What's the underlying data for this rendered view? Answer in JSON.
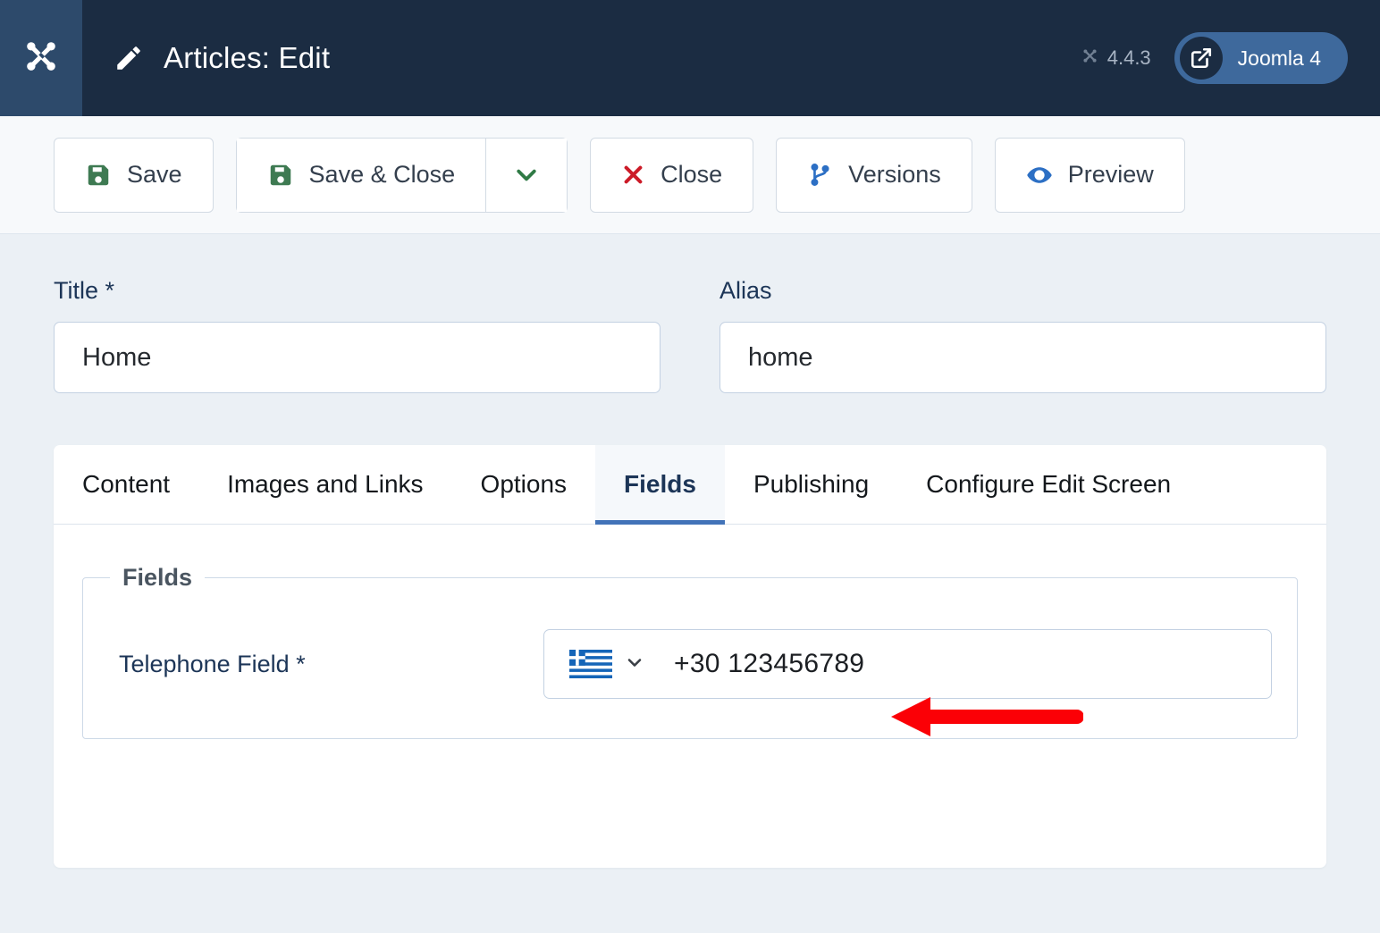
{
  "header": {
    "logo_icon": "joomla-logo-icon",
    "pencil_icon": "pencil-icon",
    "title": "Articles: Edit",
    "version_icon": "joomla-mark-icon",
    "version": "4.4.3",
    "switch_icon": "external-link-icon",
    "switch_label": "Joomla 4"
  },
  "toolbar": {
    "save_label": "Save",
    "save_icon": "floppy-disk-icon",
    "save_close_label": "Save & Close",
    "save_close_icon": "floppy-disk-icon",
    "caret_icon": "chevron-down-icon",
    "close_label": "Close",
    "close_icon": "x-icon",
    "versions_label": "Versions",
    "versions_icon": "code-branch-icon",
    "preview_label": "Preview",
    "preview_icon": "eye-icon"
  },
  "form": {
    "title_label": "Title *",
    "title_value": "Home",
    "title_placeholder": "",
    "alias_label": "Alias",
    "alias_value": "home",
    "alias_placeholder": ""
  },
  "tabs": [
    {
      "label": "Content",
      "active": false
    },
    {
      "label": "Images and Links",
      "active": false
    },
    {
      "label": "Options",
      "active": false
    },
    {
      "label": "Fields",
      "active": true
    },
    {
      "label": "Publishing",
      "active": false
    },
    {
      "label": "Configure Edit Screen",
      "active": false
    }
  ],
  "fieldset": {
    "legend": "Fields",
    "telephone": {
      "label": "Telephone Field *",
      "flag_icon": "greece-flag-icon",
      "flag_country": "Greece",
      "chevron_icon": "chevron-down-icon",
      "value": "+30 123456789",
      "placeholder": ""
    }
  },
  "annotation": {
    "arrow_icon": "left-arrow-annotation-icon",
    "arrow_color": "#fb0006"
  },
  "colors": {
    "header_bg": "#1b2c42",
    "logo_bg": "#2d4a6b",
    "page_bg": "#ebf0f5",
    "accent_blue": "#4273b8",
    "save_green": "#3e7a52",
    "close_red": "#cc1b28",
    "label_navy": "#1c3557"
  }
}
